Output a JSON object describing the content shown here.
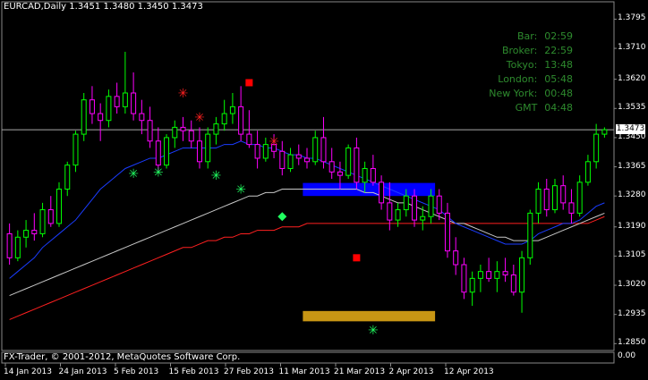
{
  "header": {
    "symbol": "EURCAD,Daily",
    "open": "1.3451",
    "high": "1.3480",
    "low": "1.3450",
    "close": "1.3473"
  },
  "clock": [
    {
      "label": "Bar:",
      "value": "02:59"
    },
    {
      "label": "Broker:",
      "value": "22:59"
    },
    {
      "label": "Tokyo:",
      "value": "13:48"
    },
    {
      "label": "London:",
      "value": "05:48"
    },
    {
      "label": "New York:",
      "value": "00:48"
    },
    {
      "label": "GMT",
      "value": "04:48"
    }
  ],
  "price_axis": [
    "1.3795",
    "1.3710",
    "1.3620",
    "1.3535",
    "1.3450",
    "1.3365",
    "1.3280",
    "1.3190",
    "1.3105",
    "1.3020",
    "1.2935",
    "1.2850"
  ],
  "current_price": "1.3473",
  "subwindow_zero": "0.00",
  "date_axis": [
    "14 Jan 2013",
    "24 Jan 2013",
    "5 Feb 2013",
    "15 Feb 2013",
    "27 Feb 2013",
    "11 Mar 2013",
    "21 Mar 2013",
    "2 Apr 2013",
    "12 Apr 2013"
  ],
  "copyright": "FX-Trader, © 2001-2012, MetaQuotes Software Corp.",
  "colors": {
    "bull": "#00ff00",
    "bear": "#ff00ff",
    "ma_fast": "#1a3cff",
    "ma_mid": "#c8c8c8",
    "ma_slow": "#ff2020",
    "zone_top": "#0000ff",
    "zone_bottom": "#c89614"
  },
  "chart_data": {
    "type": "candlestick",
    "ylim": [
      1.283,
      1.383
    ],
    "candles": [
      [
        1.317,
        1.32,
        1.308,
        1.31
      ],
      [
        1.31,
        1.318,
        1.309,
        1.316
      ],
      [
        1.316,
        1.321,
        1.313,
        1.318
      ],
      [
        1.318,
        1.323,
        1.315,
        1.317
      ],
      [
        1.317,
        1.326,
        1.316,
        1.324
      ],
      [
        1.324,
        1.328,
        1.319,
        1.32
      ],
      [
        1.32,
        1.332,
        1.319,
        1.33
      ],
      [
        1.33,
        1.338,
        1.328,
        1.337
      ],
      [
        1.337,
        1.347,
        1.335,
        1.346
      ],
      [
        1.346,
        1.358,
        1.344,
        1.356
      ],
      [
        1.356,
        1.36,
        1.349,
        1.352
      ],
      [
        1.352,
        1.355,
        1.344,
        1.35
      ],
      [
        1.35,
        1.359,
        1.348,
        1.357
      ],
      [
        1.357,
        1.361,
        1.352,
        1.354
      ],
      [
        1.354,
        1.37,
        1.352,
        1.358
      ],
      [
        1.358,
        1.364,
        1.35,
        1.352
      ],
      [
        1.352,
        1.356,
        1.346,
        1.35
      ],
      [
        1.35,
        1.354,
        1.342,
        1.344
      ],
      [
        1.344,
        1.348,
        1.335,
        1.337
      ],
      [
        1.337,
        1.346,
        1.336,
        1.345
      ],
      [
        1.345,
        1.35,
        1.342,
        1.348
      ],
      [
        1.348,
        1.351,
        1.344,
        1.347
      ],
      [
        1.347,
        1.35,
        1.342,
        1.344
      ],
      [
        1.344,
        1.348,
        1.336,
        1.338
      ],
      [
        1.338,
        1.348,
        1.336,
        1.346
      ],
      [
        1.346,
        1.351,
        1.343,
        1.349
      ],
      [
        1.349,
        1.356,
        1.347,
        1.352
      ],
      [
        1.352,
        1.358,
        1.349,
        1.354
      ],
      [
        1.354,
        1.36,
        1.344,
        1.346
      ],
      [
        1.346,
        1.353,
        1.342,
        1.343
      ],
      [
        1.343,
        1.347,
        1.336,
        1.339
      ],
      [
        1.339,
        1.345,
        1.338,
        1.343
      ],
      [
        1.343,
        1.346,
        1.339,
        1.341
      ],
      [
        1.341,
        1.344,
        1.334,
        1.336
      ],
      [
        1.336,
        1.342,
        1.335,
        1.34
      ],
      [
        1.34,
        1.343,
        1.337,
        1.339
      ],
      [
        1.339,
        1.342,
        1.336,
        1.338
      ],
      [
        1.338,
        1.347,
        1.337,
        1.345
      ],
      [
        1.345,
        1.351,
        1.336,
        1.338
      ],
      [
        1.338,
        1.342,
        1.333,
        1.335
      ],
      [
        1.335,
        1.338,
        1.33,
        1.334
      ],
      [
        1.334,
        1.343,
        1.333,
        1.342
      ],
      [
        1.342,
        1.345,
        1.33,
        1.332
      ],
      [
        1.332,
        1.338,
        1.329,
        1.336
      ],
      [
        1.336,
        1.34,
        1.331,
        1.332
      ],
      [
        1.332,
        1.334,
        1.324,
        1.326
      ],
      [
        1.326,
        1.332,
        1.318,
        1.321
      ],
      [
        1.321,
        1.326,
        1.319,
        1.324
      ],
      [
        1.324,
        1.33,
        1.322,
        1.328
      ],
      [
        1.328,
        1.33,
        1.319,
        1.321
      ],
      [
        1.321,
        1.325,
        1.318,
        1.322
      ],
      [
        1.322,
        1.33,
        1.32,
        1.328
      ],
      [
        1.328,
        1.33,
        1.321,
        1.323
      ],
      [
        1.323,
        1.326,
        1.31,
        1.312
      ],
      [
        1.312,
        1.316,
        1.305,
        1.308
      ],
      [
        1.308,
        1.31,
        1.298,
        1.3
      ],
      [
        1.3,
        1.306,
        1.296,
        1.304
      ],
      [
        1.304,
        1.308,
        1.3,
        1.306
      ],
      [
        1.306,
        1.31,
        1.303,
        1.304
      ],
      [
        1.304,
        1.309,
        1.3,
        1.306
      ],
      [
        1.306,
        1.31,
        1.303,
        1.305
      ],
      [
        1.305,
        1.308,
        1.299,
        1.3
      ],
      [
        1.3,
        1.312,
        1.294,
        1.31
      ],
      [
        1.31,
        1.324,
        1.308,
        1.323
      ],
      [
        1.323,
        1.332,
        1.32,
        1.33
      ],
      [
        1.33,
        1.333,
        1.322,
        1.324
      ],
      [
        1.324,
        1.333,
        1.323,
        1.331
      ],
      [
        1.331,
        1.334,
        1.324,
        1.326
      ],
      [
        1.326,
        1.33,
        1.32,
        1.323
      ],
      [
        1.323,
        1.334,
        1.322,
        1.332
      ],
      [
        1.332,
        1.34,
        1.331,
        1.338
      ],
      [
        1.338,
        1.349,
        1.336,
        1.346
      ],
      [
        1.346,
        1.348,
        1.345,
        1.3473
      ]
    ],
    "ma_fast": [
      1.304,
      1.306,
      1.308,
      1.31,
      1.313,
      1.315,
      1.317,
      1.319,
      1.321,
      1.324,
      1.327,
      1.33,
      1.332,
      1.334,
      1.336,
      1.337,
      1.338,
      1.339,
      1.339,
      1.34,
      1.341,
      1.342,
      1.342,
      1.342,
      1.342,
      1.342,
      1.343,
      1.343,
      1.344,
      1.343,
      1.343,
      1.342,
      1.342,
      1.341,
      1.34,
      1.34,
      1.339,
      1.339,
      1.338,
      1.337,
      1.336,
      1.335,
      1.334,
      1.333,
      1.332,
      1.331,
      1.33,
      1.329,
      1.328,
      1.327,
      1.326,
      1.325,
      1.324,
      1.322,
      1.32,
      1.319,
      1.318,
      1.317,
      1.316,
      1.315,
      1.314,
      1.314,
      1.314,
      1.315,
      1.317,
      1.318,
      1.319,
      1.32,
      1.32,
      1.321,
      1.323,
      1.325,
      1.326
    ],
    "ma_mid": [
      1.299,
      1.3,
      1.301,
      1.302,
      1.303,
      1.304,
      1.305,
      1.306,
      1.307,
      1.308,
      1.309,
      1.31,
      1.311,
      1.312,
      1.313,
      1.314,
      1.315,
      1.316,
      1.317,
      1.318,
      1.319,
      1.32,
      1.321,
      1.322,
      1.323,
      1.324,
      1.325,
      1.326,
      1.327,
      1.328,
      1.328,
      1.329,
      1.329,
      1.33,
      1.33,
      1.33,
      1.33,
      1.33,
      1.33,
      1.33,
      1.33,
      1.33,
      1.33,
      1.329,
      1.329,
      1.328,
      1.327,
      1.326,
      1.326,
      1.325,
      1.324,
      1.323,
      1.322,
      1.321,
      1.32,
      1.32,
      1.319,
      1.318,
      1.317,
      1.316,
      1.316,
      1.315,
      1.315,
      1.315,
      1.315,
      1.316,
      1.317,
      1.318,
      1.319,
      1.32,
      1.321,
      1.322,
      1.323
    ],
    "ma_slow": [
      1.292,
      1.293,
      1.294,
      1.295,
      1.296,
      1.297,
      1.298,
      1.299,
      1.3,
      1.301,
      1.302,
      1.303,
      1.304,
      1.305,
      1.306,
      1.307,
      1.308,
      1.309,
      1.31,
      1.311,
      1.312,
      1.313,
      1.313,
      1.314,
      1.315,
      1.315,
      1.316,
      1.316,
      1.317,
      1.317,
      1.318,
      1.318,
      1.318,
      1.319,
      1.319,
      1.319,
      1.32,
      1.32,
      1.32,
      1.32,
      1.32,
      1.32,
      1.32,
      1.32,
      1.32,
      1.32,
      1.32,
      1.32,
      1.32,
      1.32,
      1.32,
      1.32,
      1.32,
      1.32,
      1.32,
      1.32,
      1.32,
      1.32,
      1.32,
      1.32,
      1.32,
      1.32,
      1.32,
      1.32,
      1.32,
      1.32,
      1.32,
      1.32,
      1.32,
      1.32,
      1.32,
      1.321,
      1.322
    ],
    "markers": [
      {
        "type": "green-star",
        "i": 15,
        "price": 1.3345
      },
      {
        "type": "green-star",
        "i": 18,
        "price": 1.335
      },
      {
        "type": "red-star",
        "i": 21,
        "price": 1.358
      },
      {
        "type": "red-star",
        "i": 23,
        "price": 1.351
      },
      {
        "type": "green-star",
        "i": 25,
        "price": 1.334
      },
      {
        "type": "green-star",
        "i": 28,
        "price": 1.33
      },
      {
        "type": "red-square",
        "i": 29,
        "price": 1.361
      },
      {
        "type": "red-star",
        "i": 32,
        "price": 1.344
      },
      {
        "type": "green-diamond",
        "i": 33,
        "price": 1.322
      },
      {
        "type": "red-square",
        "i": 42,
        "price": 1.31
      },
      {
        "type": "green-star",
        "i": 44,
        "price": 1.289
      }
    ],
    "zones": [
      {
        "name": "supply",
        "x0": 1.3318,
        "x1": 1.328,
        "from": 36,
        "to": 51
      },
      {
        "name": "demand",
        "x0": 1.2945,
        "x1": 1.2915,
        "from": 36,
        "to": 51
      }
    ]
  }
}
